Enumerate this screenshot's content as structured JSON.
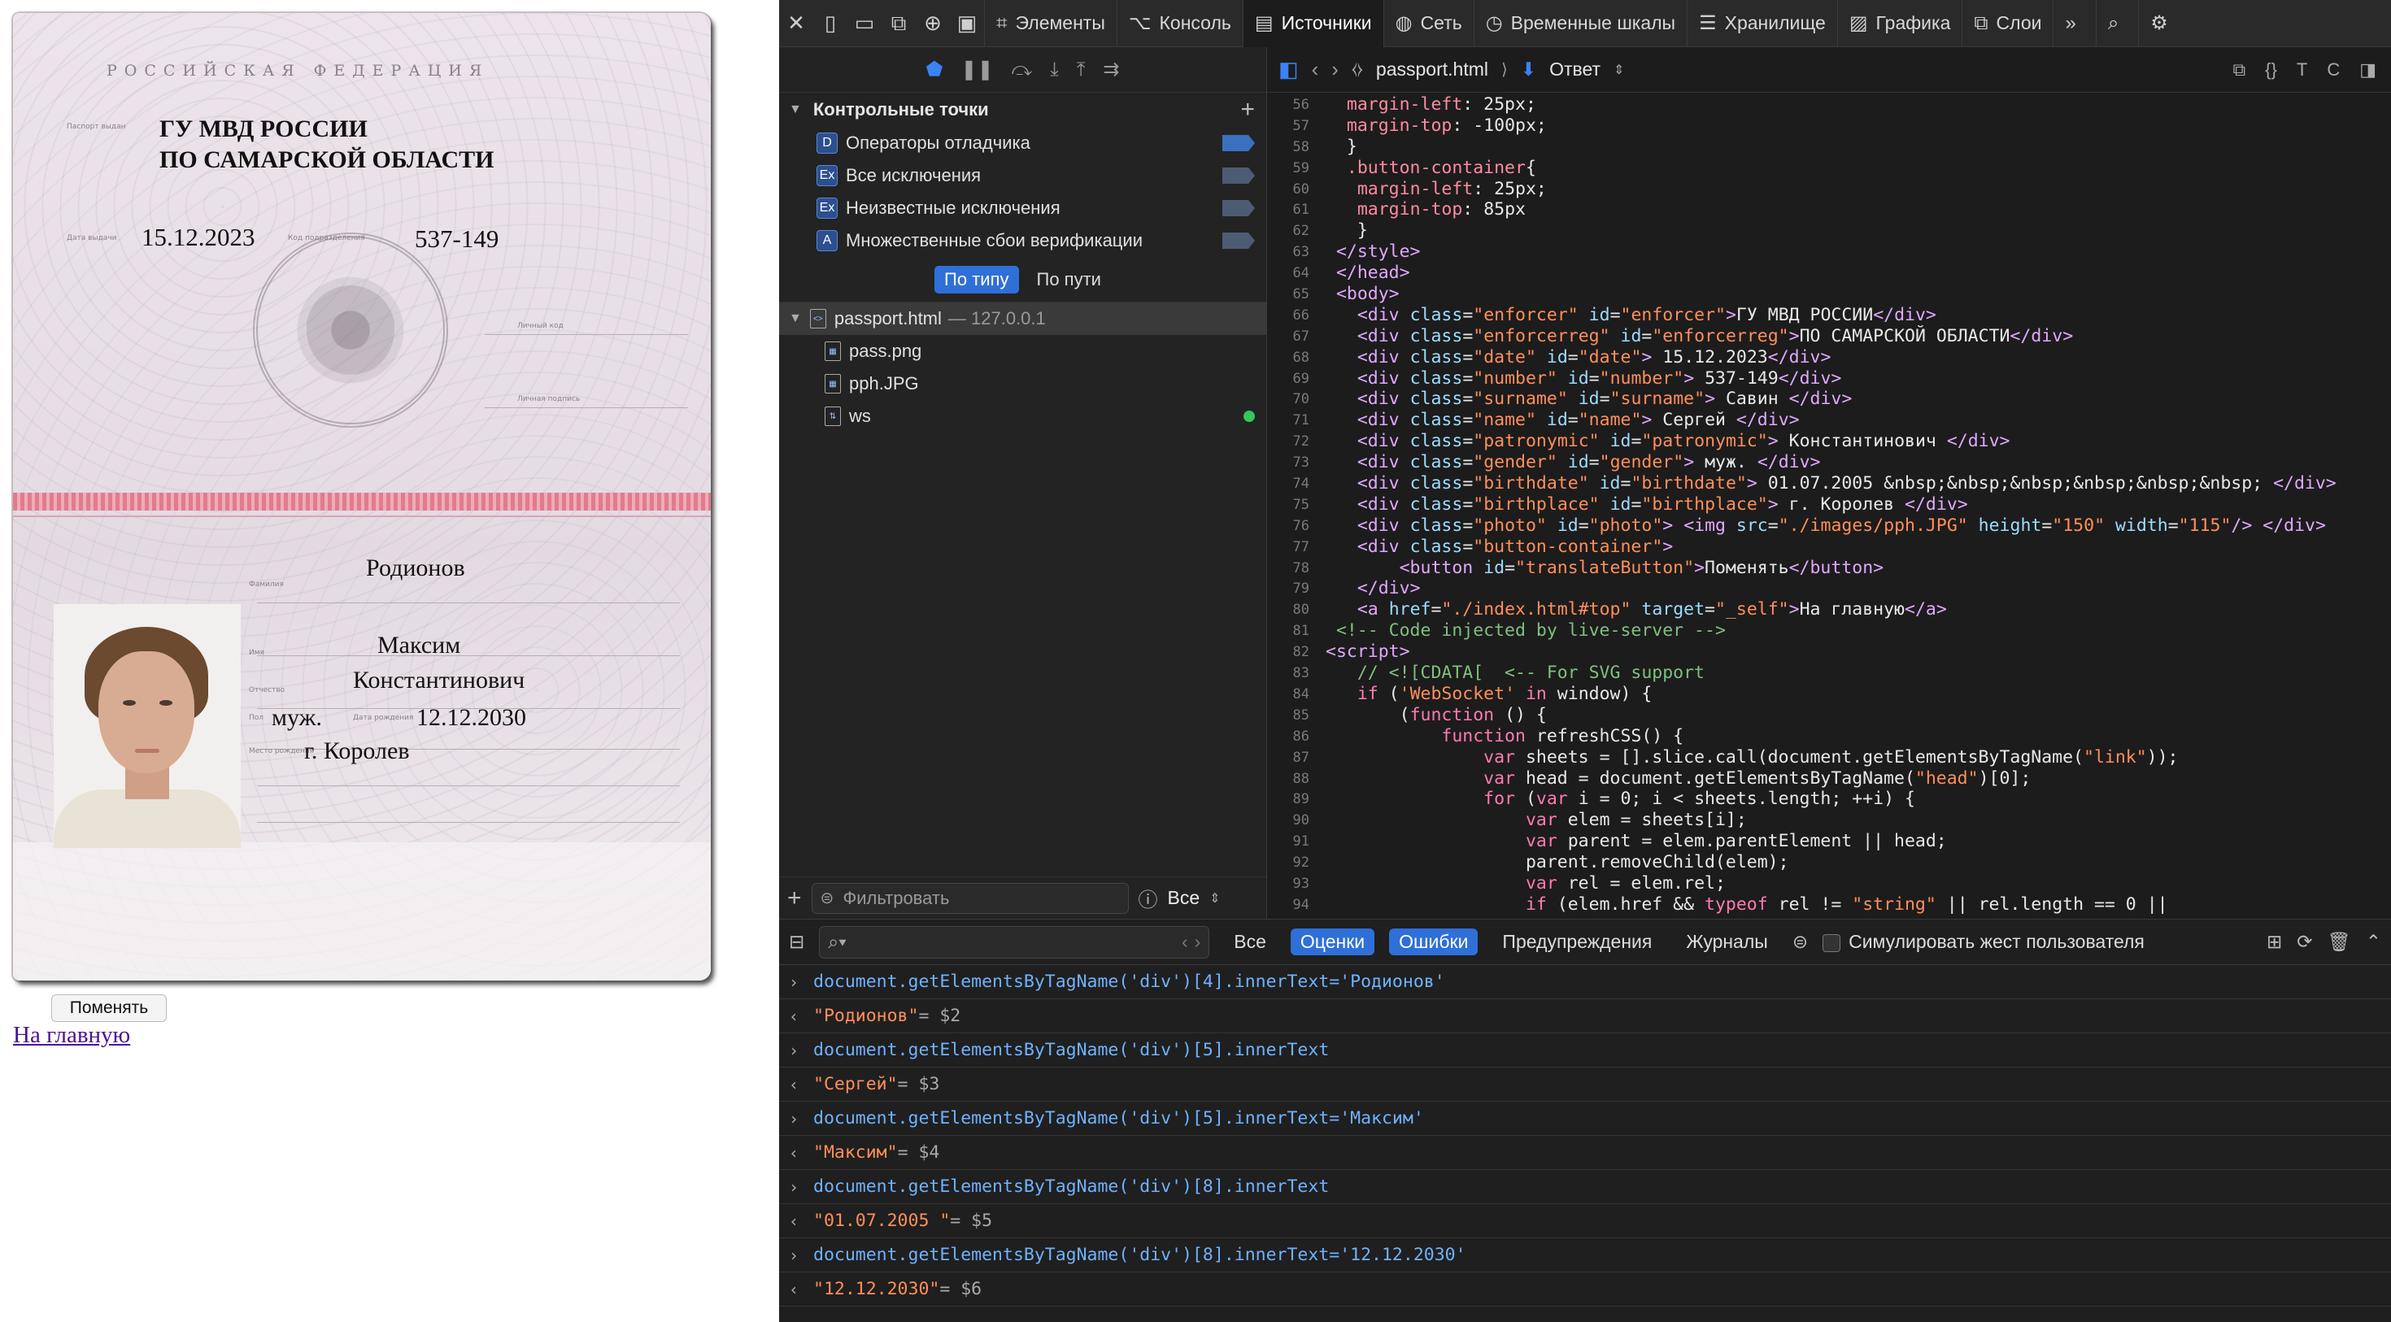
{
  "passport": {
    "header": "РОССИЙСКАЯ ФЕДЕРАЦИЯ",
    "issuer_line1": "ГУ МВД РОССИИ",
    "issuer_line2": "ПО САМАРСКОЙ ОБЛАСТИ",
    "issue_date": "15.12.2023",
    "dept_code": "537-149",
    "surname": "Родионов",
    "name": "Максим",
    "patronymic": "Константинович",
    "gender": "муж.",
    "birthdate": "12.12.2030",
    "birthplace": "г. Королев",
    "small_labels": {
      "issued_by": "Паспорт выдан",
      "issue_date": "Дата выдачи",
      "code": "Код подразделения",
      "signature1": "Личный код",
      "signature2": "Личная подпись",
      "surname": "Фамилия",
      "name": "Имя",
      "patronymic": "Отчество",
      "gender": "Пол",
      "birthdate": "Дата рождения",
      "birthplace": "Место рождения"
    }
  },
  "page": {
    "change_button": "Поменять",
    "home_link": "На главную"
  },
  "devtools": {
    "tabs": [
      "Элементы",
      "Консоль",
      "Источники",
      "Сеть",
      "Временные шкалы",
      "Хранилище",
      "Графика",
      "Слои"
    ],
    "active_tab": "Источники",
    "breakpoints_title": "Контрольные точки",
    "breakpoints": [
      {
        "badge": "D",
        "label": "Операторы отладчика"
      },
      {
        "badge": "Ex",
        "label": "Все исключения"
      },
      {
        "badge": "Ex",
        "label": "Неизвестные исключения"
      },
      {
        "badge": "A",
        "label": "Множественные сбои верификации"
      }
    ],
    "group_by": [
      "По типу",
      "По пути"
    ],
    "tree": {
      "root": "passport.html",
      "root_host": "— 127.0.0.1",
      "children": [
        "pass.png",
        "pph.JPG",
        "ws"
      ]
    },
    "filter_placeholder": "Фильтровать",
    "filter_scope": "Все",
    "editor": {
      "file": "passport.html",
      "response": "Ответ"
    },
    "code_lines": [
      {
        "n": "56",
        "html": "  <span class='tok-prop'>margin-left</span>: <span class='tok-val'>25px</span>;"
      },
      {
        "n": "57",
        "html": "  <span class='tok-prop'>margin-top</span>: <span class='tok-val'>-100px</span>;"
      },
      {
        "n": "58",
        "html": "  }"
      },
      {
        "n": "59",
        "html": "  <span class='tok-prop'>.button-container</span>{"
      },
      {
        "n": "60",
        "html": "   <span class='tok-prop'>margin-left</span>: <span class='tok-val'>25px</span>;"
      },
      {
        "n": "61",
        "html": "   <span class='tok-prop'>margin-top</span>: <span class='tok-val'>85px</span>"
      },
      {
        "n": "62",
        "html": "   }"
      },
      {
        "n": "63",
        "html": " <span class='tok-tag'>&lt;/style&gt;</span>"
      },
      {
        "n": "64",
        "html": " <span class='tok-tag'>&lt;/head&gt;</span>"
      },
      {
        "n": "65",
        "html": " <span class='tok-tag'>&lt;body&gt;</span>"
      },
      {
        "n": "66",
        "html": "   <span class='tok-tag'>&lt;div</span> <span class='tok-attr'>class</span>=<span class='tok-str'>\"enforcer\"</span> <span class='tok-attr'>id</span>=<span class='tok-str'>\"enforcer\"</span><span class='tok-tag'>&gt;</span>ГУ МВД РОССИИ<span class='tok-tag'>&lt;/div&gt;</span>"
      },
      {
        "n": "67",
        "html": "   <span class='tok-tag'>&lt;div</span> <span class='tok-attr'>class</span>=<span class='tok-str'>\"enforcerreg\"</span> <span class='tok-attr'>id</span>=<span class='tok-str'>\"enforcerreg\"</span><span class='tok-tag'>&gt;</span>ПО САМАРСКОЙ ОБЛАСТИ<span class='tok-tag'>&lt;/div&gt;</span>"
      },
      {
        "n": "68",
        "html": "   <span class='tok-tag'>&lt;div</span> <span class='tok-attr'>class</span>=<span class='tok-str'>\"date\"</span> <span class='tok-attr'>id</span>=<span class='tok-str'>\"date\"</span><span class='tok-tag'>&gt;</span> 15.12.2023<span class='tok-tag'>&lt;/div&gt;</span>"
      },
      {
        "n": "69",
        "html": "   <span class='tok-tag'>&lt;div</span> <span class='tok-attr'>class</span>=<span class='tok-str'>\"number\"</span> <span class='tok-attr'>id</span>=<span class='tok-str'>\"number\"</span><span class='tok-tag'>&gt;</span> 537-149<span class='tok-tag'>&lt;/div&gt;</span>"
      },
      {
        "n": "70",
        "html": "   <span class='tok-tag'>&lt;div</span> <span class='tok-attr'>class</span>=<span class='tok-str'>\"surname\"</span> <span class='tok-attr'>id</span>=<span class='tok-str'>\"surname\"</span><span class='tok-tag'>&gt;</span> Савин <span class='tok-tag'>&lt;/div&gt;</span>"
      },
      {
        "n": "71",
        "html": "   <span class='tok-tag'>&lt;div</span> <span class='tok-attr'>class</span>=<span class='tok-str'>\"name\"</span> <span class='tok-attr'>id</span>=<span class='tok-str'>\"name\"</span><span class='tok-tag'>&gt;</span> Сергей <span class='tok-tag'>&lt;/div&gt;</span>"
      },
      {
        "n": "72",
        "html": "   <span class='tok-tag'>&lt;div</span> <span class='tok-attr'>class</span>=<span class='tok-str'>\"patronymic\"</span> <span class='tok-attr'>id</span>=<span class='tok-str'>\"patronymic\"</span><span class='tok-tag'>&gt;</span> Константинович <span class='tok-tag'>&lt;/div&gt;</span>"
      },
      {
        "n": "73",
        "html": "   <span class='tok-tag'>&lt;div</span> <span class='tok-attr'>class</span>=<span class='tok-str'>\"gender\"</span> <span class='tok-attr'>id</span>=<span class='tok-str'>\"gender\"</span><span class='tok-tag'>&gt;</span> муж. <span class='tok-tag'>&lt;/div&gt;</span>"
      },
      {
        "n": "74",
        "html": "   <span class='tok-tag'>&lt;div</span> <span class='tok-attr'>class</span>=<span class='tok-str'>\"birthdate\"</span> <span class='tok-attr'>id</span>=<span class='tok-str'>\"birthdate\"</span><span class='tok-tag'>&gt;</span> 01.07.2005 &amp;nbsp;&amp;nbsp;&amp;nbsp;&amp;nbsp;&amp;nbsp;&amp;nbsp; <span class='tok-tag'>&lt;/div&gt;</span>"
      },
      {
        "n": "75",
        "html": "   <span class='tok-tag'>&lt;div</span> <span class='tok-attr'>class</span>=<span class='tok-str'>\"birthplace\"</span> <span class='tok-attr'>id</span>=<span class='tok-str'>\"birthplace\"</span><span class='tok-tag'>&gt;</span> г. Королев <span class='tok-tag'>&lt;/div&gt;</span>"
      },
      {
        "n": "76",
        "html": "   <span class='tok-tag'>&lt;div</span> <span class='tok-attr'>class</span>=<span class='tok-str'>\"photo\"</span> <span class='tok-attr'>id</span>=<span class='tok-str'>\"photo\"</span><span class='tok-tag'>&gt;</span> <span class='tok-tag'>&lt;img</span> <span class='tok-attr'>src</span>=<span class='tok-str'>\"./images/pph.JPG\"</span> <span class='tok-attr'>height</span>=<span class='tok-str'>\"150\"</span> <span class='tok-attr'>width</span>=<span class='tok-str'>\"115\"</span><span class='tok-tag'>/&gt;</span> <span class='tok-tag'>&lt;/div&gt;</span>"
      },
      {
        "n": "77",
        "html": "   <span class='tok-tag'>&lt;div</span> <span class='tok-attr'>class</span>=<span class='tok-str'>\"button-container\"</span><span class='tok-tag'>&gt;</span>"
      },
      {
        "n": "78",
        "html": "       <span class='tok-tag'>&lt;button</span> <span class='tok-attr'>id</span>=<span class='tok-str'>\"translateButton\"</span><span class='tok-tag'>&gt;</span>Поменять<span class='tok-tag'>&lt;/button&gt;</span>"
      },
      {
        "n": "79",
        "html": "   <span class='tok-tag'>&lt;/div&gt;</span>"
      },
      {
        "n": "80",
        "html": "   <span class='tok-tag'>&lt;a</span> <span class='tok-attr'>href</span>=<span class='tok-str'>\"./index.html#top\"</span> <span class='tok-attr'>target</span>=<span class='tok-str'>\"_self\"</span><span class='tok-tag'>&gt;</span>На главную<span class='tok-tag'>&lt;/a&gt;</span>"
      },
      {
        "n": "81",
        "html": " <span class='tok-cm'>&lt;!-- Code injected by live-server --&gt;</span>"
      },
      {
        "n": "82",
        "html": "<span class='tok-tag'>&lt;script&gt;</span>"
      },
      {
        "n": "83",
        "html": "   <span class='tok-cm'>// &lt;![CDATA[  &lt;-- For SVG support</span>"
      },
      {
        "n": "84",
        "html": "   <span class='tok-kw'>if</span> (<span class='tok-str'>'WebSocket'</span> <span class='tok-kw'>in</span> window) {"
      },
      {
        "n": "85",
        "html": "       (<span class='tok-kw'>function</span> () {"
      },
      {
        "n": "86",
        "html": "           <span class='tok-kw'>function</span> refreshCSS() {"
      },
      {
        "n": "87",
        "html": "               <span class='tok-kw'>var</span> sheets = [].slice.call(document.getElementsByTagName(<span class='tok-str'>\"link\"</span>));"
      },
      {
        "n": "88",
        "html": "               <span class='tok-kw'>var</span> head = document.getElementsByTagName(<span class='tok-str'>\"head\"</span>)[0];"
      },
      {
        "n": "89",
        "html": "               <span class='tok-kw'>for</span> (<span class='tok-kw'>var</span> i = 0; i &lt; sheets.length; ++i) {"
      },
      {
        "n": "90",
        "html": "                   <span class='tok-kw'>var</span> elem = sheets[i];"
      },
      {
        "n": "91",
        "html": "                   <span class='tok-kw'>var</span> parent = elem.parentElement || head;"
      },
      {
        "n": "92",
        "html": "                   parent.removeChild(elem);"
      },
      {
        "n": "93",
        "html": "                   <span class='tok-kw'>var</span> rel = elem.rel;"
      },
      {
        "n": "94",
        "html": "                   <span class='tok-kw'>if</span> (elem.href &amp;&amp; <span class='tok-kw'>typeof</span> rel != <span class='tok-str'>\"string\"</span> || rel.length == 0 ||"
      }
    ],
    "console": {
      "filters": [
        "Все",
        "Оценки",
        "Ошибки",
        "Предупреждения",
        "Журналы"
      ],
      "selected_filters": [
        "Оценки",
        "Ошибки"
      ],
      "simulate_label": "Симулировать жест пользователя",
      "messages": [
        {
          "type": "in",
          "text": "document.getElementsByTagName('div')[4].innerText='Родионов'"
        },
        {
          "type": "out",
          "text": "\"Родионов\"",
          "ref": " = $2"
        },
        {
          "type": "in",
          "text": "document.getElementsByTagName('div')[5].innerText"
        },
        {
          "type": "out",
          "text": "\"Сергей\"",
          "ref": " = $3"
        },
        {
          "type": "in",
          "text": "document.getElementsByTagName('div')[5].innerText='Максим'"
        },
        {
          "type": "out",
          "text": "\"Максим\"",
          "ref": " = $4"
        },
        {
          "type": "in",
          "text": "document.getElementsByTagName('div')[8].innerText"
        },
        {
          "type": "out",
          "text": "\"01.07.2005      \"",
          "ref": " = $5"
        },
        {
          "type": "in",
          "text": "document.getElementsByTagName('div')[8].innerText='12.12.2030'"
        },
        {
          "type": "out",
          "text": "\"12.12.2030\"",
          "ref": " = $6"
        }
      ]
    }
  }
}
